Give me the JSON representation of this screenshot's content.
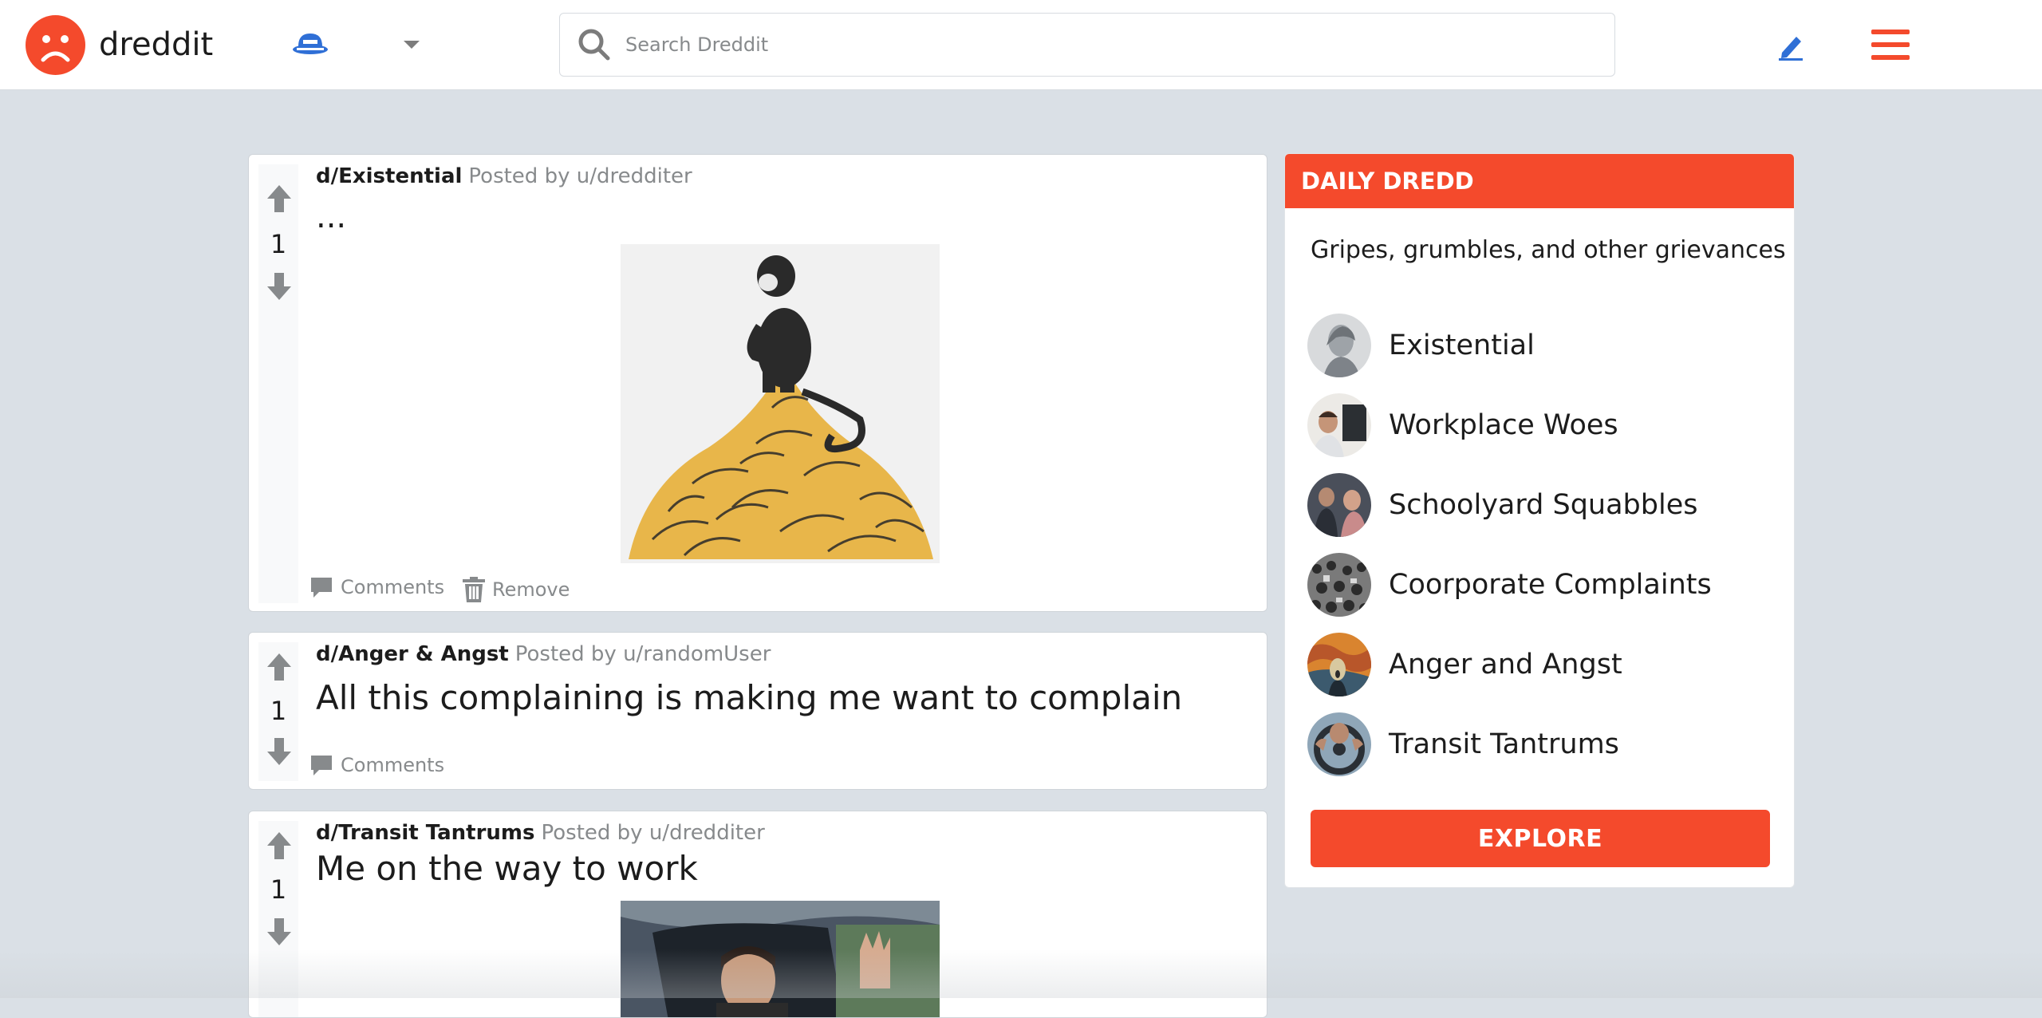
{
  "app": {
    "name": "dreddit",
    "accent_color": "#f44a2c",
    "logo_icon": "sad-face-icon",
    "user_icon": "user-avatar-icon"
  },
  "header": {
    "search_placeholder": "Search Dreddit",
    "create_icon": "pencil-icon",
    "menu_icon": "hamburger-menu-icon"
  },
  "posts": [
    {
      "community": "d/Existential",
      "posted_by_prefix": "Posted by",
      "author": "u/dredditer",
      "score": "1",
      "title": "...",
      "image": "monkey-on-bananas",
      "actions": {
        "comments": "Comments",
        "remove": "Remove"
      }
    },
    {
      "community": "d/Anger & Angst",
      "posted_by_prefix": "Posted by",
      "author": "u/randomUser",
      "score": "1",
      "title": "All this complaining is making me want to complain",
      "actions": {
        "comments": "Comments"
      }
    },
    {
      "community": "d/Transit Tantrums",
      "posted_by_prefix": "Posted by",
      "author": "u/dredditer",
      "score": "1",
      "title": "Me on the way to work",
      "image": "angry-driver-in-car"
    }
  ],
  "sidebar": {
    "title": "DAILY DREDD",
    "tagline": "Gripes, grumbles, and other grievances",
    "communities": [
      {
        "label": "Existential",
        "thumb": "statue"
      },
      {
        "label": "Workplace Woes",
        "thumb": "office-worker"
      },
      {
        "label": "Schoolyard Squabbles",
        "thumb": "students"
      },
      {
        "label": "Coorporate Complaints",
        "thumb": "crowd"
      },
      {
        "label": "Anger and Angst",
        "thumb": "the-scream"
      },
      {
        "label": "Transit Tantrums",
        "thumb": "steering-wheel"
      }
    ],
    "explore_label": "EXPLORE"
  }
}
